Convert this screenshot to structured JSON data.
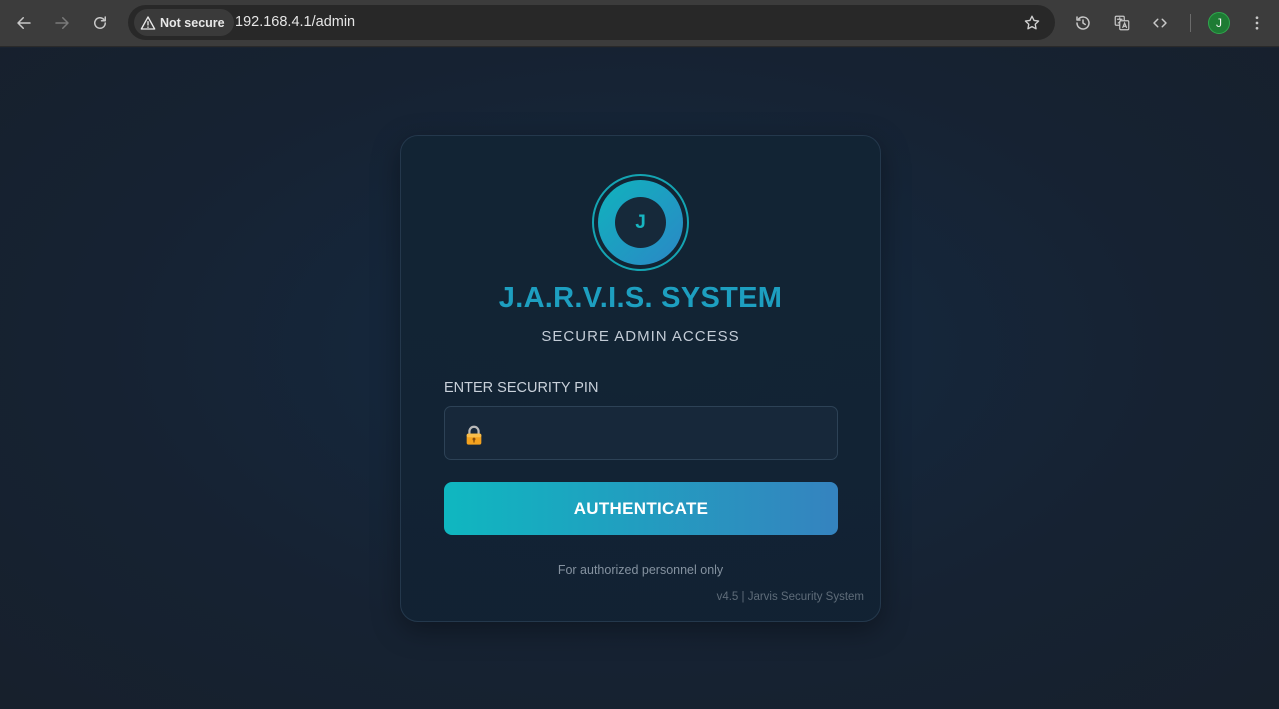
{
  "browser": {
    "security_chip": "Not secure",
    "url": "192.168.4.1/admin",
    "profile_initial": "J",
    "icons": {
      "back": "back-arrow-icon",
      "forward": "forward-arrow-icon",
      "reload": "reload-icon",
      "warning": "warning-triangle-icon",
      "bookmark": "star-icon",
      "history": "history-icon",
      "translate": "translate-icon",
      "devtools": "code-icon",
      "menu": "kebab-menu-icon"
    }
  },
  "login": {
    "logo_letter": "J",
    "title": "J.A.R.V.I.S. SYSTEM",
    "subtitle": "SECURE ADMIN ACCESS",
    "pin_label": "ENTER SECURITY PIN",
    "pin_value": "",
    "pin_placeholder": "",
    "lock_icon": "lock-icon",
    "button_label": "AUTHENTICATE",
    "note": "For authorized personnel only",
    "version_text": "v4.5 | Jarvis Security System"
  },
  "colors": {
    "accent_teal": "#0fb7c0",
    "accent_blue": "#3583bf",
    "title_color": "#1d9fc0",
    "page_bg": "#15263a"
  }
}
